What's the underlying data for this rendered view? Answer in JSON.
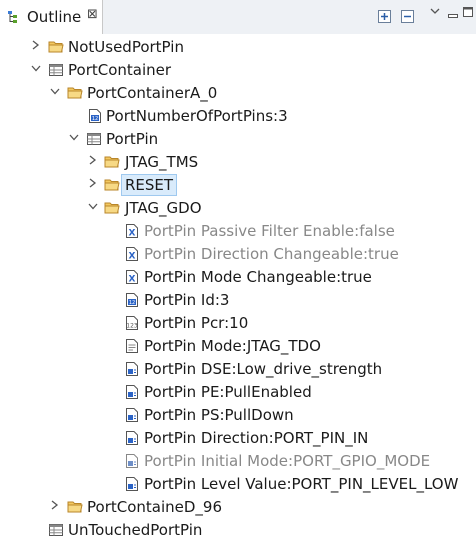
{
  "view": {
    "title": "Outline",
    "close_glyph": "⊠"
  },
  "toolbar": {
    "expand_icon": "expand-all-icon",
    "collapse_icon": "collapse-all-icon",
    "menu_icon": "view-menu-icon",
    "min_icon": "minimize-icon",
    "max_icon": "maximize-icon"
  },
  "tree": {
    "items": [
      {
        "label": "NotUsedPortPin",
        "icon": "folder-icon"
      },
      {
        "label": "PortContainer",
        "icon": "table-icon"
      },
      {
        "label": "PortContainerA_0",
        "icon": "folder-icon"
      },
      {
        "label": "PortNumberOfPortPins:3",
        "icon": "number-param-icon"
      },
      {
        "label": "PortPin",
        "icon": "table-icon"
      },
      {
        "label": "JTAG_TMS",
        "icon": "folder-icon"
      },
      {
        "label": "RESET",
        "icon": "folder-icon"
      },
      {
        "label": "JTAG_GDO",
        "icon": "folder-icon"
      },
      {
        "label": "PortPin Passive Filter Enable:false",
        "icon": "boolean-param-icon"
      },
      {
        "label": "PortPin Direction Changeable:true",
        "icon": "boolean-param-icon"
      },
      {
        "label": "PortPin Mode Changeable:true",
        "icon": "boolean-param-icon"
      },
      {
        "label": "PortPin Id:3",
        "icon": "number-param-icon"
      },
      {
        "label": "PortPin Pcr:10",
        "icon": "integer-param-icon"
      },
      {
        "label": "PortPin Mode:JTAG_TDO",
        "icon": "document-param-icon"
      },
      {
        "label": "PortPin DSE:Low_drive_strength",
        "icon": "enum-param-icon"
      },
      {
        "label": "PortPin PE:PullEnabled",
        "icon": "enum-param-icon"
      },
      {
        "label": "PortPin PS:PullDown",
        "icon": "enum-param-icon"
      },
      {
        "label": "PortPin Direction:PORT_PIN_IN",
        "icon": "enum-param-icon"
      },
      {
        "label": "PortPin Initial Mode:PORT_GPIO_MODE",
        "icon": "enum-param-icon"
      },
      {
        "label": "PortPin Level Value:PORT_PIN_LEVEL_LOW",
        "icon": "enum-param-icon"
      },
      {
        "label": "PortContaineD_96",
        "icon": "folder-icon"
      },
      {
        "label": "UnTouchedPortPin",
        "icon": "table-icon"
      }
    ]
  },
  "colors": {
    "selection_bg": "#d9ebfb",
    "selection_border": "#9fc9ef",
    "folder": "#e8b84a",
    "dim_text": "#888888",
    "param_blue": "#2b63c6"
  }
}
